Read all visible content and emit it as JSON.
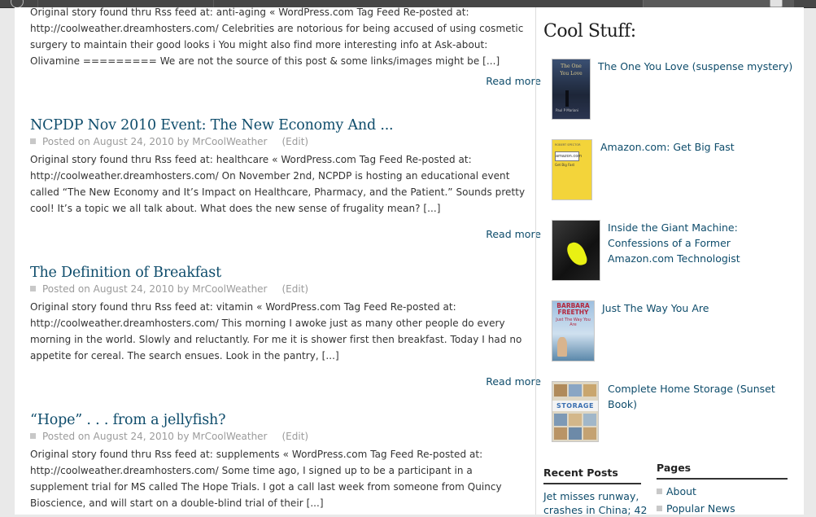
{
  "posts": [
    {
      "title": "",
      "excerpt": "Original story found thru Rss feed at: anti-aging « WordPress.com Tag Feed Re-posted at: http://coolweather.dreamhosters.com/ Celebrities are notorious for being accused of using cosmetic surgery to maintain their good looks i You might also find more interesting info at Ask-about: Olivamine ========= We are not the source of this post & some links/images might be [...]",
      "read_more": "Read more"
    },
    {
      "title": "NCPDP Nov 2010 Event: The New Economy And ...",
      "meta_posted": "Posted on August 24, 2010 by MrCoolWeather",
      "meta_edit": "(Edit)",
      "excerpt": "Original story found thru Rss feed at: healthcare « WordPress.com Tag Feed Re-posted at: http://coolweather.dreamhosters.com/ On November 2nd, NCPDP is hosting an educational event called “The New Economy and It’s Impact on Healthcare, Pharmacy, and the Patient.” Sounds pretty cool! It’s a topic we all talk about. What does the new sense of frugality mean? [...]",
      "read_more": "Read more"
    },
    {
      "title": "The Definition of Breakfast",
      "meta_posted": "Posted on August 24, 2010 by MrCoolWeather",
      "meta_edit": "(Edit)",
      "excerpt": "Original story found thru Rss feed at: vitamin « WordPress.com Tag Feed Re-posted at: http://coolweather.dreamhosters.com/ This morning I awoke just as many other people do every morning in the world.  Slowly and reluctantly.  For me it is shower first then breakfast.  Today I had no appetite for cereal.  The search ensues.  Look in the pantry, [...]",
      "read_more": "Read more"
    },
    {
      "title": "“Hope” . . . from a jellyfish?",
      "meta_posted": "Posted on August 24, 2010 by MrCoolWeather",
      "meta_edit": "(Edit)",
      "excerpt": "Original story found thru Rss feed at: supplements « WordPress.com Tag Feed Re-posted at: http://coolweather.dreamhosters.com/ Some time ago, I signed up to be a participant in a supplement trial for MS called The Hope Trials. I got a call last week from someone from Quincy Bioscience, and will start on a double-blind trial of their [...]"
    }
  ],
  "sidebar": {
    "cool_stuff_heading": "Cool Stuff:",
    "books": [
      {
        "title": "The One You Love (suspense mystery)",
        "cover_text": "The One You Love",
        "cover_author": "Paul P Mariani"
      },
      {
        "title": "Amazon.com: Get Big Fast",
        "cover_text": "ROBERT SPECTOR",
        "cover_logo": "amazon.com",
        "cover_sub": "Get Big Fast"
      },
      {
        "title": "Inside the Giant Machine: Confessions of a Former Amazon.com Technologist"
      },
      {
        "title": "Just The Way You Are",
        "cover_text": "BARBARA FREETHY",
        "cover_sub": "Just The Way You Are"
      },
      {
        "title": "Complete Home Storage (Sunset Book)",
        "cover_text": "STORAGE"
      }
    ],
    "recent_posts_title": "Recent Posts",
    "recent_posts": [
      "Jet misses runway, crashes in China; 42"
    ],
    "pages_title": "Pages",
    "pages": [
      "About",
      "Popular News"
    ]
  },
  "colors": {
    "link": "#0e4c6b",
    "meta": "#9b9b9b",
    "admin_bar": "#464646"
  }
}
